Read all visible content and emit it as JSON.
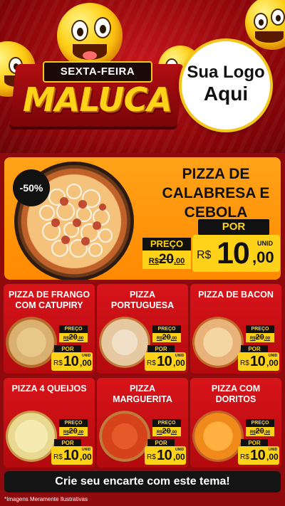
{
  "header": {
    "banner_top": "SEXTA-FEIRA",
    "banner_main": "MALUCA",
    "logo_line1": "Sua Logo",
    "logo_line2": "Aqui"
  },
  "featured": {
    "discount": "-50%",
    "title_lines": [
      "PIZZA DE",
      "CALABRESA E",
      "CEBOLA"
    ],
    "preco_label": "PREÇO",
    "por_label": "POR",
    "currency": "R$",
    "old_int": "20",
    "old_cents": ",00",
    "new_int": "10",
    "new_cents": ",00",
    "unit": "UNID"
  },
  "cards": [
    {
      "title": "PIZZA DE FRANGO COM CATUPIRY",
      "preco_label": "PREÇO",
      "old_int": "20",
      "old_cents": ",00",
      "por_label": "POR",
      "currency": "R$",
      "new_int": "10",
      "new_cents": ",00",
      "unit": "UNID"
    },
    {
      "title": "PIZZA PORTUGUESA",
      "preco_label": "PREÇO",
      "old_int": "20",
      "old_cents": ",00",
      "por_label": "POR",
      "currency": "R$",
      "new_int": "10",
      "new_cents": ",00",
      "unit": "UNID"
    },
    {
      "title": "PIZZA DE BACON",
      "preco_label": "PREÇO",
      "old_int": "20",
      "old_cents": ",00",
      "por_label": "POR",
      "currency": "R$",
      "new_int": "10",
      "new_cents": ",00",
      "unit": "UNID"
    },
    {
      "title": "PIZZA 4 QUEIJOS",
      "preco_label": "PREÇO",
      "old_int": "20",
      "old_cents": ",00",
      "por_label": "POR",
      "currency": "R$",
      "new_int": "10",
      "new_cents": ",00",
      "unit": "UNID"
    },
    {
      "title": "PIZZA MARGUERITA",
      "preco_label": "PREÇO",
      "old_int": "20",
      "old_cents": ",00",
      "por_label": "POR",
      "currency": "R$",
      "new_int": "10",
      "new_cents": ",00",
      "unit": "UNID"
    },
    {
      "title": "PIZZA COM DORITOS",
      "preco_label": "PREÇO",
      "old_int": "20",
      "old_cents": ",00",
      "por_label": "POR",
      "currency": "R$",
      "new_int": "10",
      "new_cents": ",00",
      "unit": "UNID"
    }
  ],
  "cta": "Crie seu encarte com este tema!",
  "disclaimer": "*Imagens Meramente Ilustrativas",
  "colors": {
    "accent": "#ffd21a",
    "primary": "#d8141a",
    "featured_bg": "#ff9a10"
  }
}
